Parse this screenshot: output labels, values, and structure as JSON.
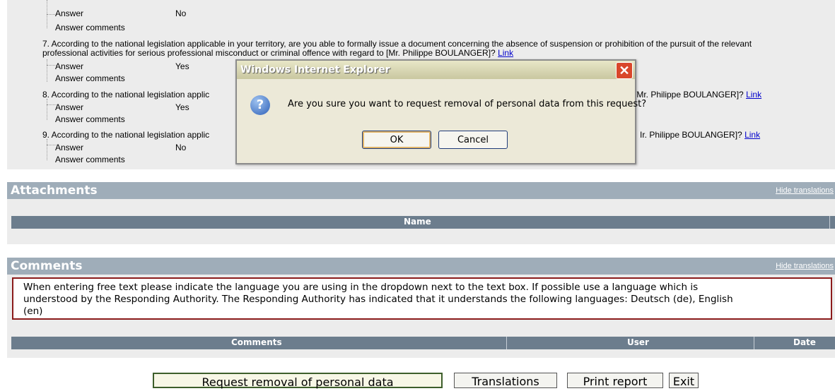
{
  "qa": {
    "q6": {
      "answer_label": "Answer",
      "answer": "No",
      "comments_label": "Answer comments"
    },
    "q7": {
      "text_line1": "7. According to the national legislation applicable in your territory, are you able to formally issue a document concerning the absence of suspension or prohibition of the pursuit of the relevant",
      "text_line2": "professional activities for serious professional misconduct or criminal offence with regard to [Mr. Philippe BOULANGER]?",
      "link": "Link",
      "answer_label": "Answer",
      "answer": "Yes",
      "comments_label": "Answer comments"
    },
    "q8": {
      "text_left": "8. According to the national legislation applic",
      "text_right": "[Mr. Philippe BOULANGER]?",
      "link": "Link",
      "answer_label": "Answer",
      "answer": "Yes",
      "comments_label": "Answer comments"
    },
    "q9": {
      "text_left": "9. According to the national legislation applic",
      "text_right": "Ir. Philippe BOULANGER]?",
      "link": "Link",
      "answer_label": "Answer",
      "answer": "No",
      "comments_label": "Answer comments"
    }
  },
  "attachments": {
    "title": "Attachments",
    "hide_translations": "Hide translations",
    "col_name": "Name"
  },
  "comments": {
    "title": "Comments",
    "hide_translations": "Hide translations",
    "notice_line1": "When entering free text please indicate the language you are using in the dropdown next to the text box. If possible use a language which is",
    "notice_line2": "understood by the Responding Authority. The Responding Authority has indicated that it understands the following languages: Deutsch (de), English",
    "notice_line3": "(en)",
    "col_comments": "Comments",
    "col_user": "User",
    "col_date": "Date"
  },
  "buttons": {
    "request_removal": "Request removal of personal data",
    "translations": "Translations",
    "print_report": "Print report",
    "exit": "Exit"
  },
  "dialog": {
    "title": "Windows Internet Explorer",
    "message": "Are you sure you want to request removal of personal data from this request?",
    "ok": "OK",
    "cancel": "Cancel",
    "icon": "question-icon"
  }
}
